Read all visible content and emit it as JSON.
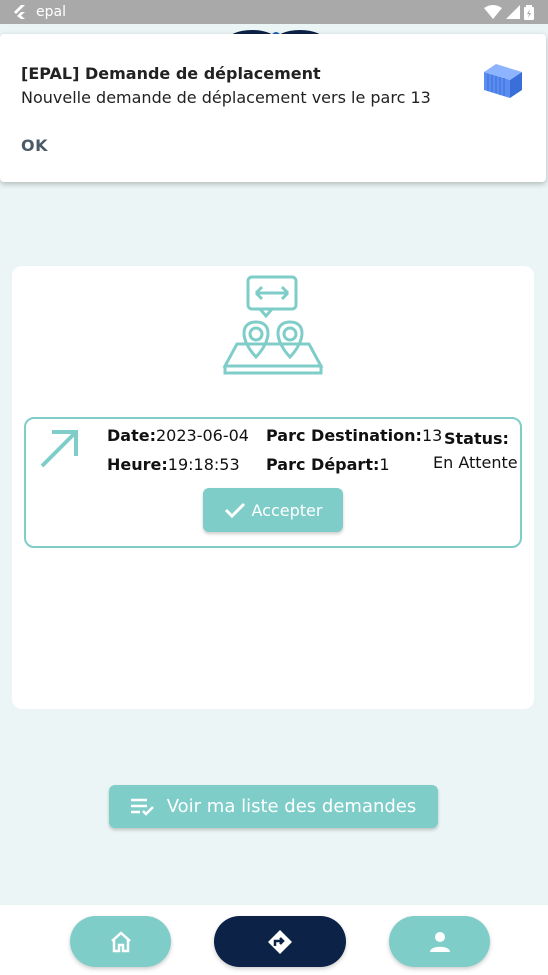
{
  "status_bar": {
    "app_name": "epal"
  },
  "notification": {
    "title": "[EPAL] Demande de déplacement",
    "body": "Nouvelle demande de déplacement vers le parc 13",
    "action": "OK",
    "icon": "container-icon"
  },
  "request": {
    "date_label": "Date:",
    "date_value": "2023-06-04",
    "time_label": "Heure:",
    "time_value": "19:18:53",
    "dest_label": "Parc Destination:",
    "dest_value": "13",
    "depart_label": "Parc Départ:",
    "depart_value": "1",
    "status_label": "Status:",
    "status_value": "En Attente",
    "accept_label": "Accepter"
  },
  "list_button": {
    "label": "Voir ma liste des demandes"
  },
  "colors": {
    "accent": "#7fcdc9",
    "navy": "#0c2246",
    "background": "#ebf5f5"
  },
  "nav": {
    "items": [
      {
        "name": "home",
        "icon": "home-icon"
      },
      {
        "name": "route",
        "icon": "route-icon"
      },
      {
        "name": "profile",
        "icon": "person-icon"
      }
    ]
  }
}
